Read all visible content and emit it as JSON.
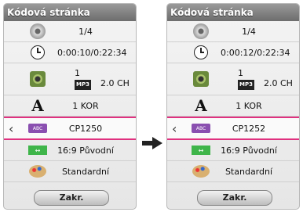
{
  "panels": [
    {
      "title": "Kódová stránka",
      "title_num": "1/4",
      "time": "0:00:10/0:22:34",
      "audio_track": "1",
      "audio_format": "MP3",
      "audio_channels": "2.0 CH",
      "subtitle_lang": "1 KOR",
      "codepage": "CP1250",
      "aspect": "16:9 Původní",
      "picture_mode": "Standardní",
      "close_label": "Zakr."
    },
    {
      "title": "Kódová stránka",
      "title_num": "1/4",
      "time": "0:00:12/0:22:34",
      "audio_track": "1",
      "audio_format": "MP3",
      "audio_channels": "2.0 CH",
      "subtitle_lang": "1 KOR",
      "codepage": "CP1252",
      "aspect": "16:9 Původní",
      "picture_mode": "Standardní",
      "close_label": "Zakr."
    }
  ],
  "icons": {
    "disc": "disc-icon",
    "clock": "clock-icon",
    "speaker": "speaker-icon",
    "font": "font-icon",
    "abc": "abc-icon",
    "aspect": "aspect-ratio-icon",
    "palette": "palette-icon",
    "arrow": "arrow-right-icon"
  },
  "colors": {
    "selection": "#e0317f",
    "header": "#6d6d6d"
  }
}
